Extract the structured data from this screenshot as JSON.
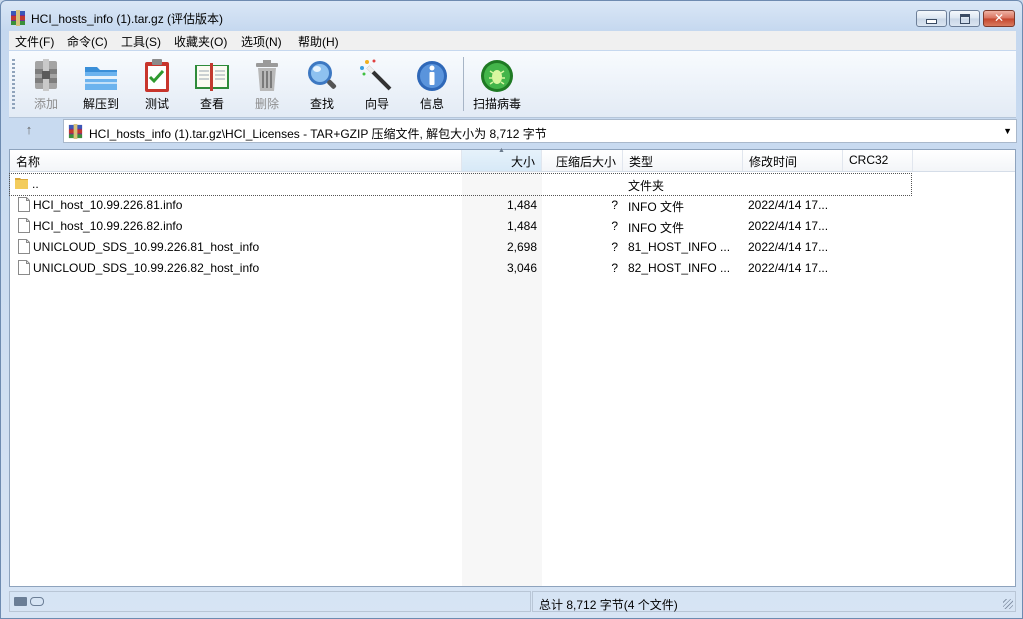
{
  "window": {
    "title": "HCI_hosts_info (1).tar.gz (评估版本)"
  },
  "menu": [
    "文件(F)",
    "命令(C)",
    "工具(S)",
    "收藏夹(O)",
    "选项(N)",
    "帮助(H)"
  ],
  "toolbar": {
    "add": "添加",
    "extract": "解压到",
    "test": "测试",
    "view": "查看",
    "delete": "删除",
    "find": "查找",
    "wizard": "向导",
    "info": "信息",
    "scan": "扫描病毒"
  },
  "address": {
    "path": "HCI_hosts_info (1).tar.gz\\HCI_Licenses - TAR+GZIP 压缩文件, 解包大小为 8,712 字节"
  },
  "columns": {
    "name": "名称",
    "size": "大小",
    "packed": "压缩后大小",
    "type": "类型",
    "modified": "修改时间",
    "crc": "CRC32"
  },
  "parent_row": {
    "name": "..",
    "type": "文件夹"
  },
  "files": [
    {
      "name": "HCI_host_10.99.226.81.info",
      "size": "1,484",
      "packed": "?",
      "type": "INFO 文件",
      "modified": "2022/4/14 17..."
    },
    {
      "name": "HCI_host_10.99.226.82.info",
      "size": "1,484",
      "packed": "?",
      "type": "INFO 文件",
      "modified": "2022/4/14 17..."
    },
    {
      "name": "UNICLOUD_SDS_10.99.226.81_host_info",
      "size": "2,698",
      "packed": "?",
      "type": "81_HOST_INFO ...",
      "modified": "2022/4/14 17..."
    },
    {
      "name": "UNICLOUD_SDS_10.99.226.82_host_info",
      "size": "3,046",
      "packed": "?",
      "type": "82_HOST_INFO ...",
      "modified": "2022/4/14 17..."
    }
  ],
  "status": {
    "summary": "总计 8,712 字节(4 个文件)"
  }
}
